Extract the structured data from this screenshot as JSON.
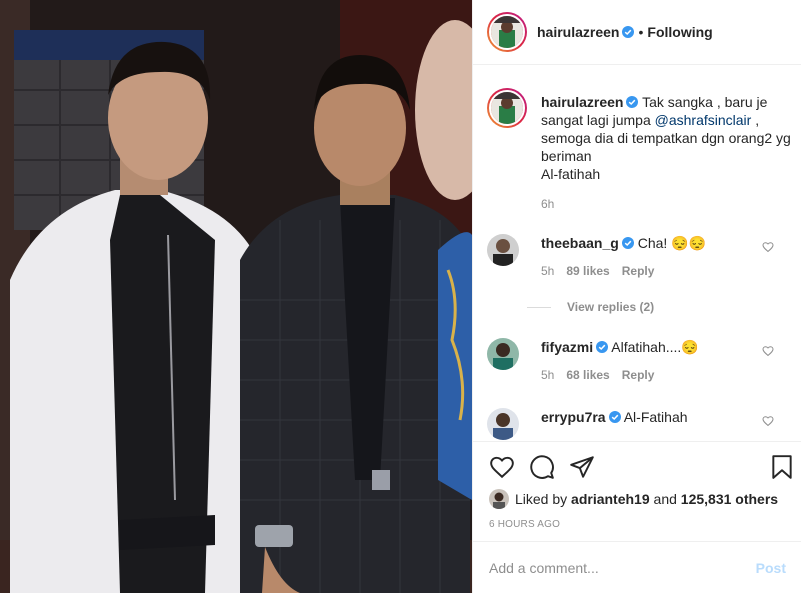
{
  "post": {
    "username": "hairulazreen",
    "follow_status": "Following",
    "dot": "•"
  },
  "caption": {
    "username": "hairulazreen",
    "text_before": "Tak sangka , baru je sangat lagi jumpa ",
    "mention": "@ashrafsinclair",
    "text_after": " , semoga dia di tempatkan dgn orang2 yg beriman",
    "line2": "Al-fatihah",
    "time": "6h"
  },
  "comments": [
    {
      "username": "theebaan_g",
      "text": "Cha! 😔😔",
      "time": "5h",
      "likes": "89 likes",
      "reply": "Reply"
    },
    {
      "username": "fifyazmi",
      "text": "Alfatihah....😔",
      "time": "5h",
      "likes": "68 likes",
      "reply": "Reply"
    },
    {
      "username": "errypu7ra",
      "text": "Al-Fatihah"
    }
  ],
  "view_replies": "View replies (2)",
  "liked_by": {
    "prefix": "Liked by ",
    "user": "adrianteh19",
    "middle": " and ",
    "count": "125,831 others"
  },
  "post_time": "6 HOURS AGO",
  "add_comment": {
    "placeholder": "Add a comment...",
    "post_label": "Post"
  },
  "icons": [
    "verified-icon",
    "heart-icon",
    "comment-icon",
    "share-icon",
    "bookmark-icon"
  ],
  "colors": {
    "verified": "#3897f0",
    "mention": "#00376b",
    "post_disabled": "#b9dcfc",
    "muted": "#8e8e8e"
  }
}
